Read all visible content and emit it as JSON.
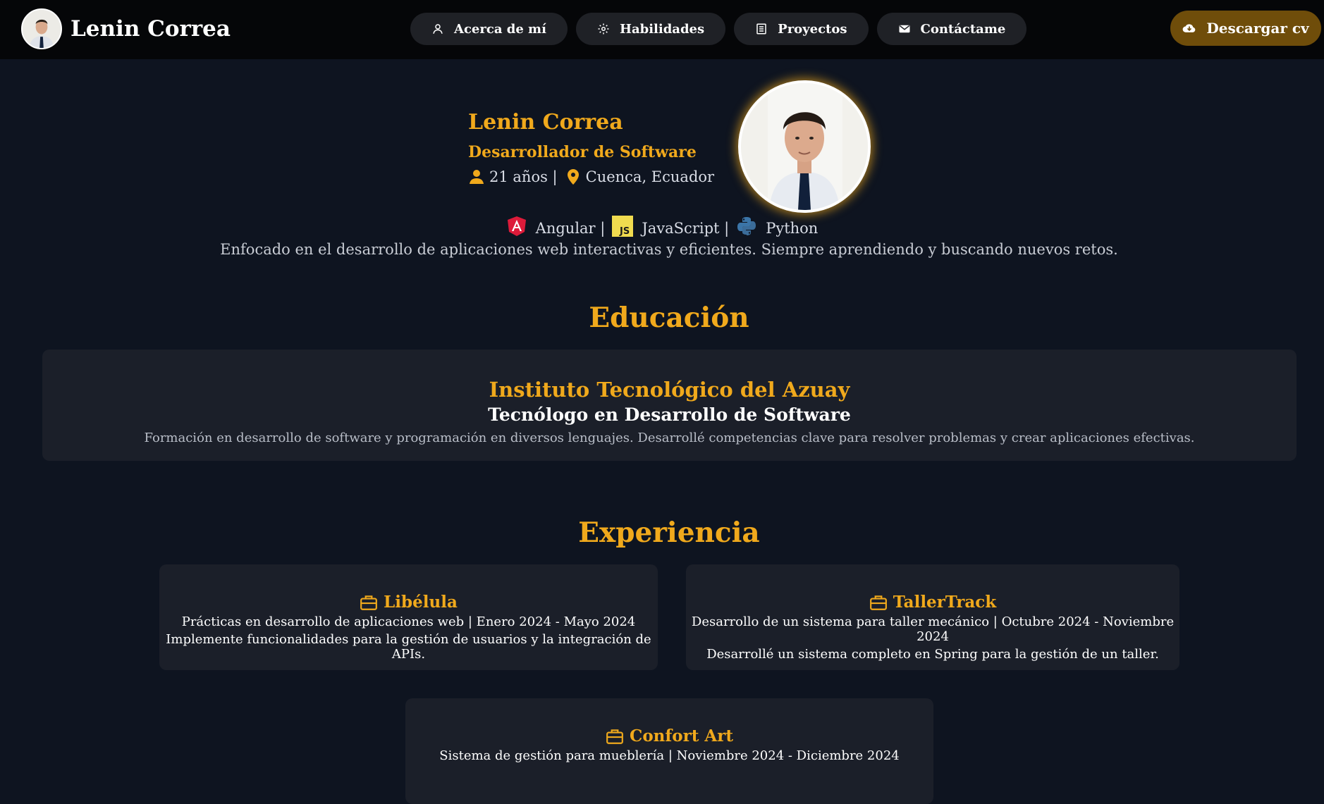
{
  "navbar": {
    "brand_name": "Lenin Correa",
    "links": [
      {
        "label": "Acerca de mí",
        "icon": "user-icon"
      },
      {
        "label": "Habilidades",
        "icon": "gear-icon"
      },
      {
        "label": "Proyectos",
        "icon": "list-icon"
      },
      {
        "label": "Contáctame",
        "icon": "mail-icon"
      }
    ],
    "cv_button": "Descargar cv"
  },
  "hero": {
    "name": "Lenin Correa",
    "role": "Desarrollador de Software",
    "age": "21 años |",
    "location": "Cuenca, Ecuador",
    "skills": [
      {
        "label": "Angular |",
        "icon": "angular-icon"
      },
      {
        "label": "JavaScript |",
        "icon": "javascript-icon"
      },
      {
        "label": "Python",
        "icon": "python-icon"
      }
    ],
    "summary": "Enfocado en el desarrollo de aplicaciones web interactivas y eficientes. Siempre aprendiendo y buscando nuevos retos."
  },
  "education": {
    "title": "Educación",
    "institution": "Instituto Tecnológico del Azuay",
    "degree": "Tecnólogo en Desarrollo de Software",
    "description": "Formación en desarrollo de software y programación en diversos lenguajes. Desarrollé competencias clave para resolver problemas y crear aplicaciones efectivas."
  },
  "experience": {
    "title": "Experiencia",
    "items": [
      {
        "company": "Libélula",
        "detail": "Prácticas en desarrollo de aplicaciones web | Enero 2024 - Mayo 2024",
        "summary": "Implemente funcionalidades para la gestión de usuarios y la integración de APIs."
      },
      {
        "company": "TallerTrack",
        "detail": "Desarrollo de un sistema para taller mecánico | Octubre 2024 - Noviembre 2024",
        "summary": "Desarrollé un sistema completo en Spring para la gestión de un taller."
      },
      {
        "company": "Confort Art",
        "detail": "Sistema de gestión para mueblería | Noviembre 2024 - Diciembre 2024",
        "summary": ""
      }
    ]
  },
  "colors": {
    "accent": "#f0a91c",
    "background": "#0e1420",
    "card": "#1b1f29",
    "navbar": "#050608"
  }
}
